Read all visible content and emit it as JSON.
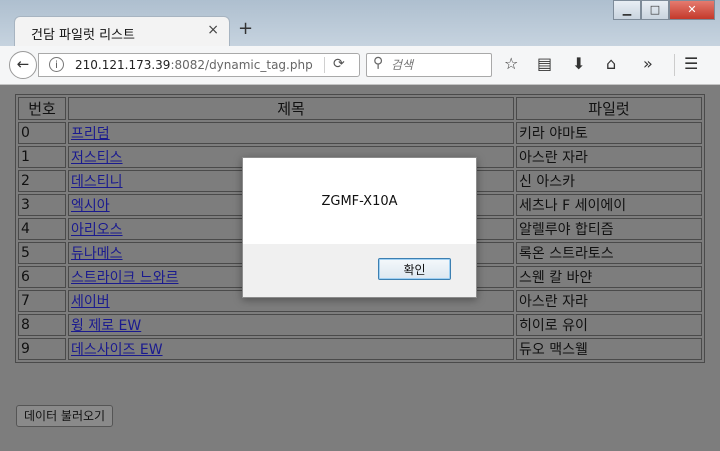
{
  "browser": {
    "tab_title": "건담 파일럿 리스트",
    "tab_close": "×",
    "new_tab": "+",
    "url_host": "210.121.173.39",
    "url_rest": ":8082/dynamic_tag.php",
    "search_placeholder": "검색",
    "window_min": "▁",
    "window_max": "□",
    "window_close": "✕",
    "icons": [
      "back-icon",
      "info-icon",
      "reload-icon",
      "search-icon",
      "bookmark-star-icon",
      "reading-list-icon",
      "download-icon",
      "home-icon",
      "overflow-chevrons-icon",
      "hamburger-menu-icon"
    ]
  },
  "table": {
    "headers": {
      "num": "번호",
      "title": "제목",
      "pilot": "파일럿"
    },
    "rows": [
      {
        "num": "0",
        "title": "프리덤",
        "pilot": "키라 야마토"
      },
      {
        "num": "1",
        "title": "저스티스",
        "pilot": "아스란 자라"
      },
      {
        "num": "2",
        "title": "데스티니",
        "pilot": "신 아스카"
      },
      {
        "num": "3",
        "title": "엑시아",
        "pilot": "세츠나 F 세이에이"
      },
      {
        "num": "4",
        "title": "아리오스",
        "pilot": "알렐루야 합티즘"
      },
      {
        "num": "5",
        "title": "듀나메스",
        "pilot": "록온 스트라토스"
      },
      {
        "num": "6",
        "title": "스트라이크 느와르",
        "pilot": "스웬 칼 바얀"
      },
      {
        "num": "7",
        "title": "세이버",
        "pilot": "아스란 자라"
      },
      {
        "num": "8",
        "title": "윙 제로 EW",
        "pilot": "히이로 유이"
      },
      {
        "num": "9",
        "title": "데스사이즈 EW",
        "pilot": "듀오 맥스웰"
      }
    ]
  },
  "load_button": "데이터 불러오기",
  "dialog": {
    "message": "ZGMF-X10A",
    "ok_label": "확인"
  }
}
